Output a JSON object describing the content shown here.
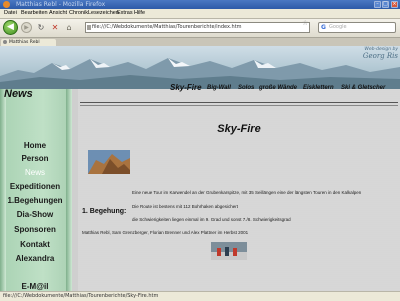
{
  "window": {
    "title": "Matthias Rebl - Mozilla Firefox"
  },
  "menu": [
    "Datei",
    "Bearbeiten",
    "Ansicht",
    "Chronik",
    "Lesezeichen",
    "Extras",
    "Hilfe"
  ],
  "address": {
    "url": "file:///C:/Webdokumente/Matthias/Tourenberichte/index.htm"
  },
  "search": {
    "engine": "G",
    "placeholder": "Google"
  },
  "tab": {
    "label": "Matthias Rebl"
  },
  "banner": {
    "webdesign": "Web-design by",
    "signature": "Georg Ris"
  },
  "sidebar": {
    "items": [
      "Home",
      "Person",
      "News",
      "Expeditionen",
      "1.Begehungen",
      "Dia-Show",
      "Sponsoren",
      "Kontakt",
      "Alexandra",
      "E-M@il"
    ],
    "active_index": 2
  },
  "content": {
    "section_title": "News",
    "topnav": [
      "Sky-Fire",
      "Big-Wall",
      "Solos",
      "große Wände",
      "Eisklettern",
      "Ski & Gletscher"
    ],
    "active_topnav": 0,
    "heading": "Sky-Fire",
    "paragraphs": [
      "Eine neue Tour im Karwendel an der Grubenkarspitze, mit 35 Seillängen eine der längsten Touren in den Kalkalpen",
      "Die Route ist bestens mit 112 Bohrhaken abgesichert",
      "die Schwierigkeiten liegen einmal im 9. Grad und sonst 7./8. Schwierigkeitsgrad"
    ],
    "first_ascent_title": "1. Begehung:",
    "first_ascent_text": "Matthias Rebl, Sam Grenzberger, Florian Brenner und Alex Plattner im Herbst 2001"
  },
  "status": {
    "text": "file:///C:/Webdokumente/Matthias/Tourenberichte/Sky-Fire.htm"
  },
  "colors": {
    "sidebar": "#bfe0c6",
    "titlebar": "#2d5aa8",
    "back_button": "#3f8f1f"
  }
}
